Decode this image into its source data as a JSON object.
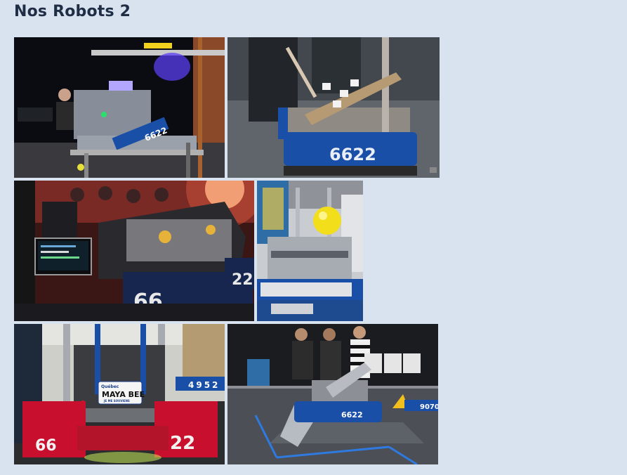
{
  "page": {
    "title": "Nos Robots 2"
  },
  "colors": {
    "background": "#d9e3f0",
    "title": "#1f2d45",
    "team_blue": "#1a4fa8",
    "team_red": "#c8102e"
  },
  "photos": [
    {
      "name": "photo-robot-stage-spotlight",
      "bumper_text": "6622"
    },
    {
      "name": "photo-robot-bumper-6622",
      "bumper_text": "6622"
    },
    {
      "name": "photo-robot-crowd-red-lights",
      "bumper_left": "66",
      "bumper_right": "22"
    },
    {
      "name": "photo-robot-pit-yellow-ball"
    },
    {
      "name": "photo-robot-red-bumper-maya-bee",
      "bumper_left": "66",
      "bumper_right": "22",
      "plate_top": "Québec",
      "plate_main": "MAYA BEE",
      "plate_bottom": "JE ME SOUVIENS",
      "field_team": "4952"
    },
    {
      "name": "photo-robot-on-field-referee",
      "bumper_text": "6622",
      "field_team": "9070"
    }
  ]
}
